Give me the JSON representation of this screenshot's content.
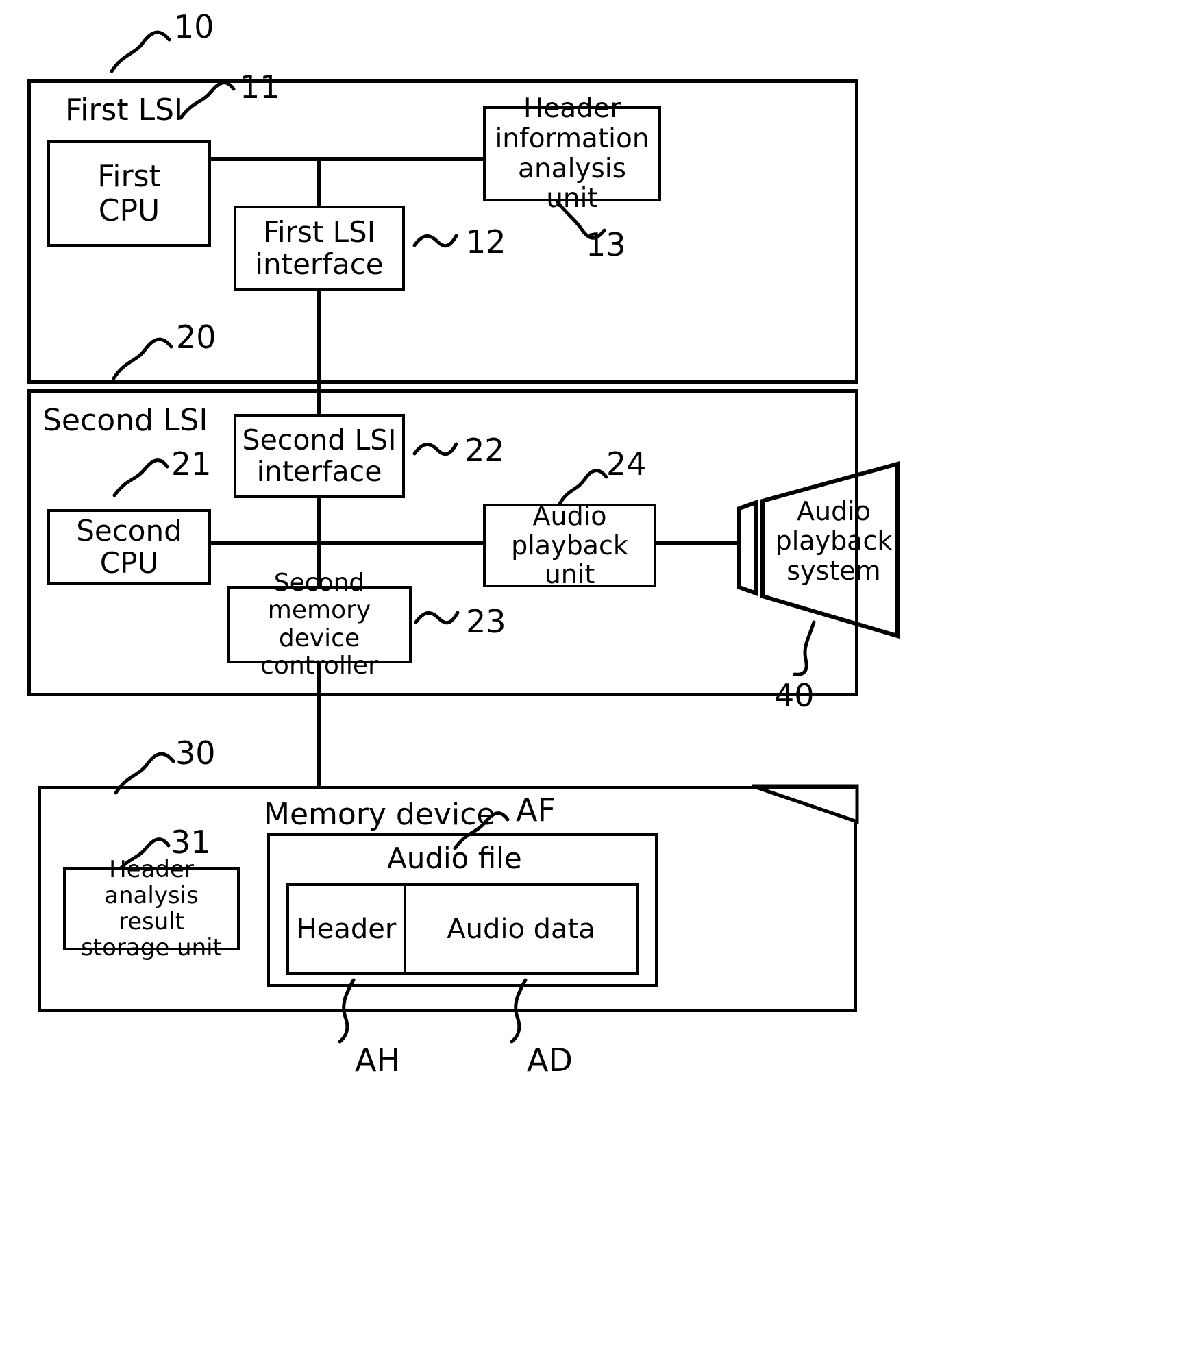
{
  "figure": {
    "type": "block-diagram",
    "description": "Audio playback apparatus block diagram with first LSI, second LSI, memory device and audio playback system"
  },
  "first_lsi": {
    "ref": "10",
    "title": "First LSI",
    "blocks": {
      "cpu": {
        "label": "First\nCPU",
        "line1": "First",
        "line2": "CPU",
        "ref": "11"
      },
      "interface": {
        "line1": "First LSI",
        "line2": "interface",
        "ref": "12"
      },
      "header_analysis": {
        "line1": "Header",
        "line2": "information",
        "line3": "analysis unit",
        "ref": "13"
      }
    }
  },
  "second_lsi": {
    "ref": "20",
    "title": "Second LSI",
    "blocks": {
      "cpu": {
        "line1": "Second",
        "line2": "CPU",
        "ref": "21"
      },
      "interface": {
        "line1": "Second LSI",
        "line2": "interface",
        "ref": "22"
      },
      "memory_controller": {
        "line1": "Second",
        "line2": "memory device",
        "line3": "controller",
        "ref": "23"
      },
      "audio_playback_unit": {
        "line1": "Audio",
        "line2": "playback unit",
        "ref": "24"
      }
    }
  },
  "audio_playback_system": {
    "ref": "40",
    "line1": "Audio",
    "line2": "playback",
    "line3": "system"
  },
  "memory_device": {
    "ref": "30",
    "title": "Memory device",
    "blocks": {
      "header_storage": {
        "line1": "Header",
        "line2": "analysis result",
        "line3": "storage unit",
        "ref": "31"
      },
      "audio_file": {
        "title": "Audio file",
        "ref": "AF"
      },
      "header": {
        "label": "Header",
        "ref": "AH"
      },
      "audio_data": {
        "label": "Audio data",
        "ref": "AD"
      }
    }
  },
  "colors": {
    "stroke": "#000000",
    "background": "#ffffff"
  }
}
